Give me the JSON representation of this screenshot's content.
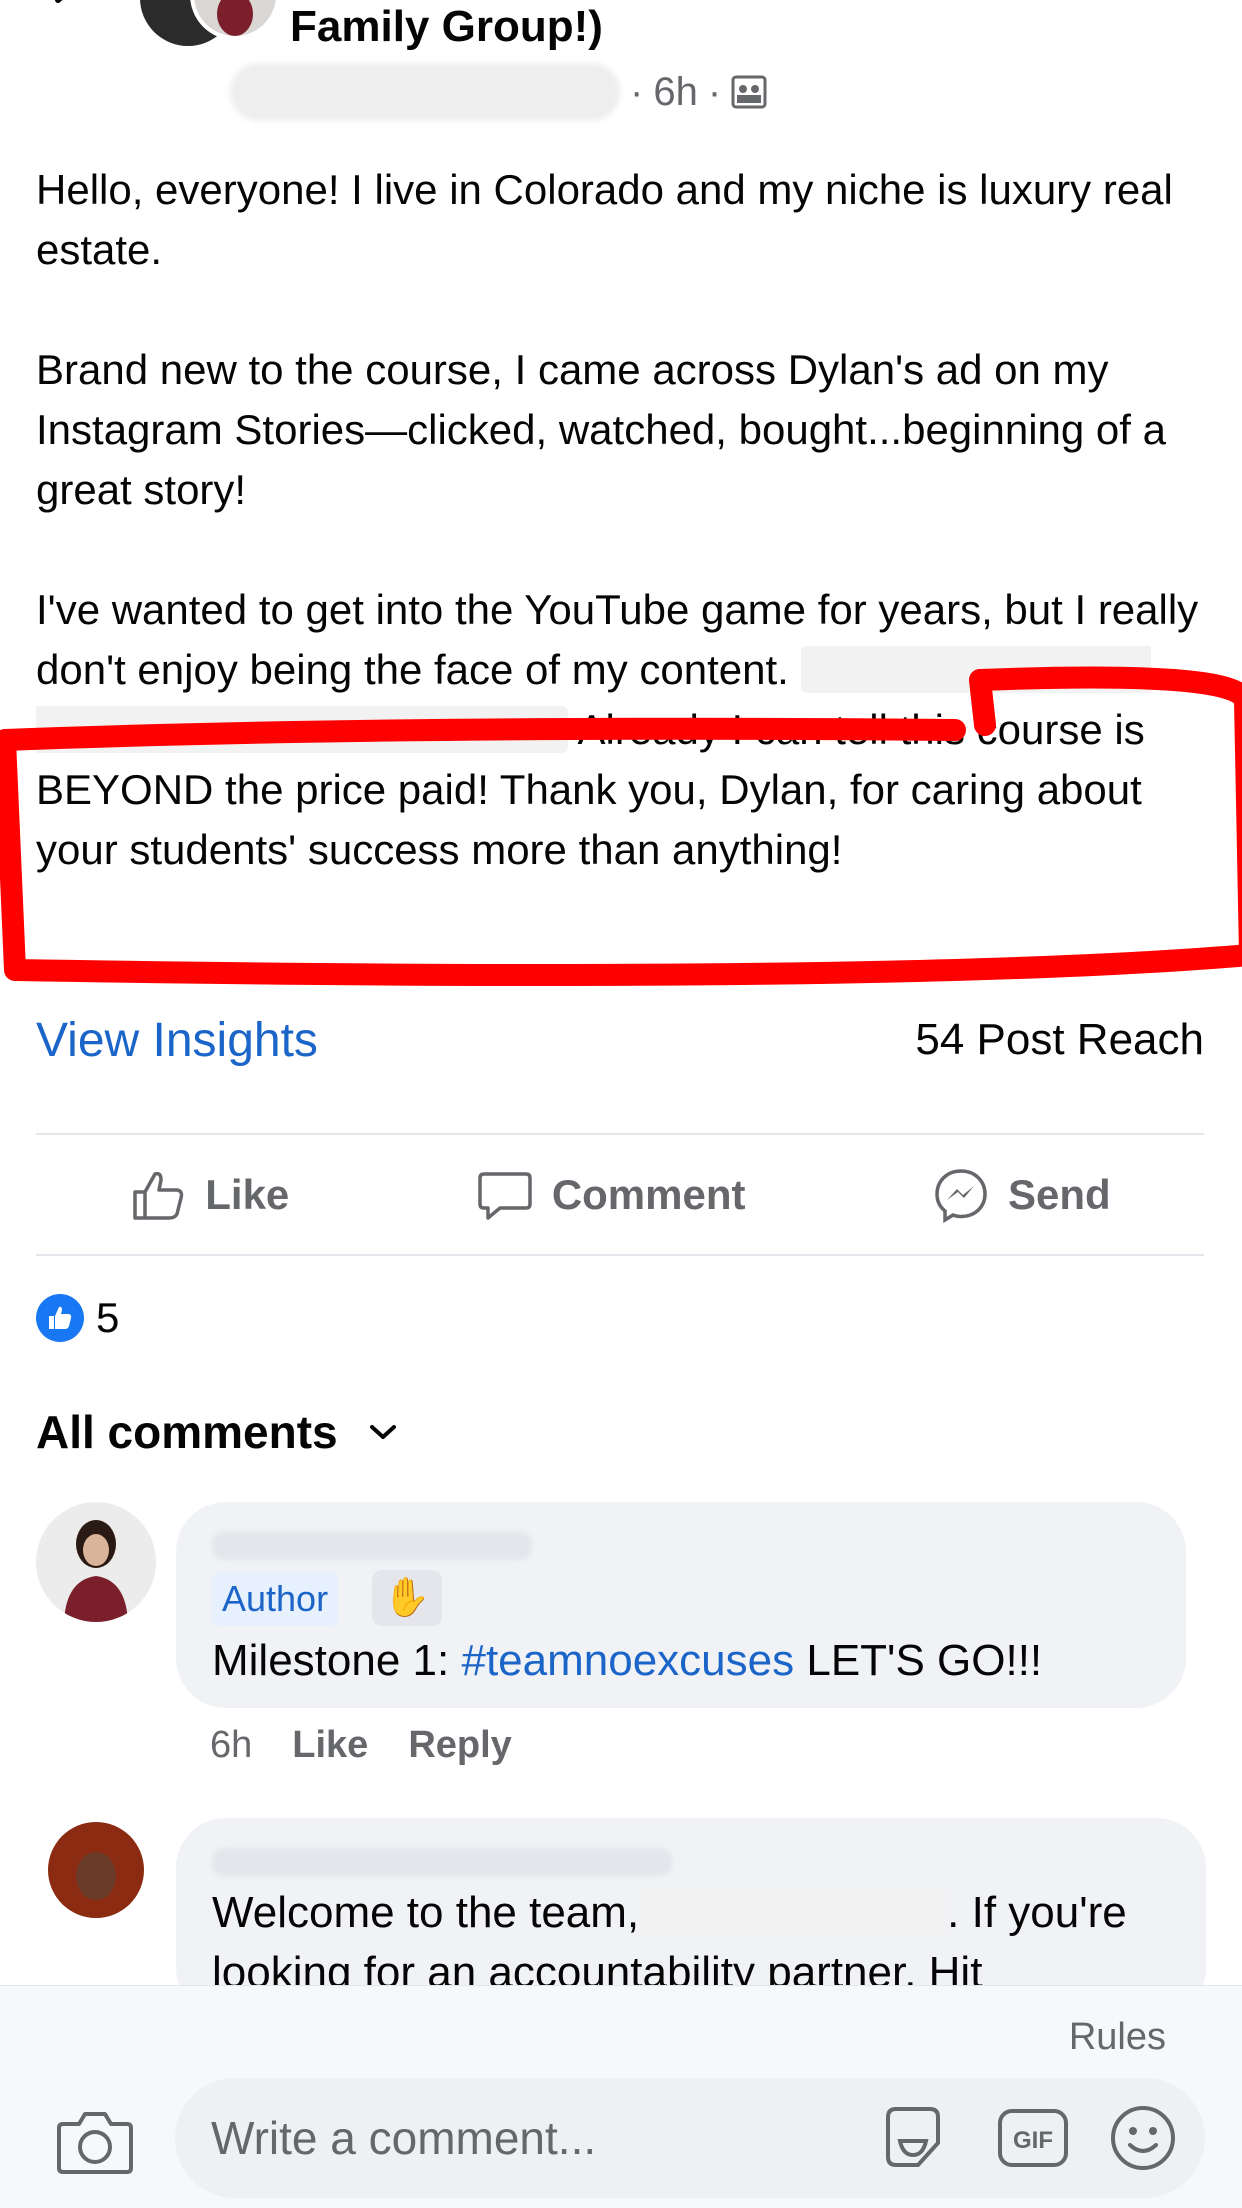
{
  "header": {
    "group_title": "Family Group!)",
    "time": "6h"
  },
  "post": {
    "paragraphs": [
      "Hello, everyone! I live in Colorado and my niche is luxury real estate.",
      "Brand new to the course, I came across Dylan's ad on my Instagram Stories—clicked, watched, bought...beginning of a great story!"
    ],
    "p3_intro": "I've wanted to get into the YouTube game for years, but I really don't enjoy being the face of my content.",
    "p3_highlight": "Already I can tell this course is BEYOND the price paid! Thank you, Dylan, for caring about your students' success more than anything!",
    "highlight_color": "#ff0000"
  },
  "insights": {
    "view_label": "View Insights",
    "reach": "54 Post Reach"
  },
  "actions": {
    "like": "Like",
    "comment": "Comment",
    "send": "Send"
  },
  "reactions": {
    "count": "5",
    "accent": "#1877f2"
  },
  "comments_header": {
    "label": "All comments"
  },
  "comments": [
    {
      "badge": "Author",
      "text_prefix": "Milestone 1: ",
      "hashtag": "#teamnoexcuses",
      "text_suffix": " LET'S GO!!!",
      "time": "6h",
      "like": "Like",
      "reply": "Reply"
    },
    {
      "text_line1_a": "Welcome to the team,",
      "text_line1_b": ". If you're",
      "text_line2": "looking for an accountability partner. Hit"
    }
  ],
  "composer": {
    "rules": "Rules",
    "placeholder": "Write a comment...",
    "gif": "GIF"
  }
}
